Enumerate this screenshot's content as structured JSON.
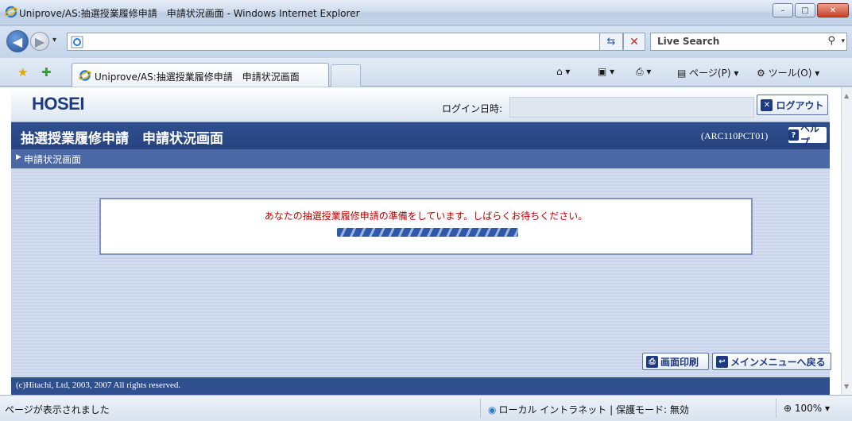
{
  "window": {
    "title": "Uniprove/AS:抽選授業履修申請　申請状況画面 - Windows Internet Explorer",
    "minimize": "–",
    "maximize": "□",
    "close": "✕"
  },
  "browser": {
    "address": "",
    "search_label": "Live Search",
    "tab_label": "Uniprove/AS:抽選授業履修申請　申請状況画面",
    "commands": {
      "page": "ページ(P)",
      "tools": "ツール(O)"
    },
    "icons": [
      "back-icon",
      "forward-icon",
      "refresh-icon",
      "stop-icon",
      "search-icon",
      "favorites-star-icon",
      "add-favorites-icon",
      "home-icon",
      "feeds-icon",
      "print-icon",
      "page-icon",
      "tools-gear-icon"
    ]
  },
  "header": {
    "logo": "HOSEI",
    "login_label": "ログイン日時:",
    "login_value": "",
    "logout_label": "ログアウト"
  },
  "page": {
    "title": "抽選授業履修申請　申請状況画面",
    "code": "(ARC110PCT01)",
    "help_label": "ヘルプ",
    "breadcrumb": "申請状況画面",
    "message": "あなたの抽選授業履修申請の準備をしています。しばらくお待ちください。",
    "print_label": "画面印刷",
    "back_label": "メインメニューへ戻る",
    "copyright": "(c)Hitachi, Ltd, 2003, 2007 All rights reserved."
  },
  "status": {
    "text": "ページが表示されました",
    "zone": "ローカル イントラネット | 保護モード: 無効",
    "zoom": "100%"
  },
  "colors": {
    "banner": "#2f4f8f",
    "breadcrumb_bar": "#4a68a6",
    "message": "#c40000",
    "progress": "#2f58a8"
  }
}
